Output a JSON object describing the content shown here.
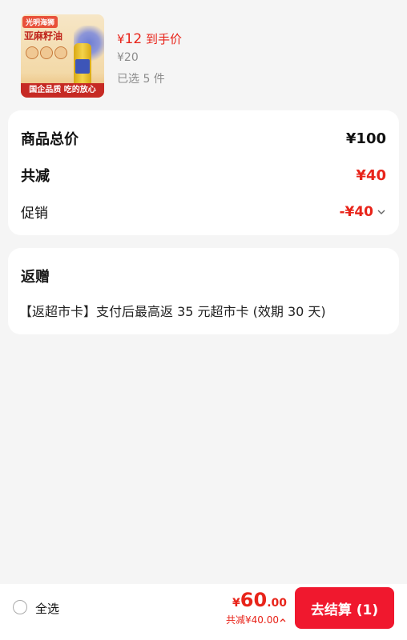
{
  "product": {
    "thumb_brand": "光明海狮",
    "thumb_name": "亚麻籽油",
    "thumb_banner": "国企品质 吃的放心",
    "hand_price_symbol": "¥",
    "hand_price_value": "12",
    "hand_price_label": "到手价",
    "original_price": "¥20",
    "selected_count": "已选 5 件"
  },
  "summary": {
    "total_label": "商品总价",
    "total_value": "¥100",
    "reduce_label": "共减",
    "reduce_value": "¥40",
    "promo_label": "促销",
    "promo_value": "-¥40"
  },
  "gift": {
    "title": "返赠",
    "text": "【返超市卡】支付后最高返 35 元超市卡 (效期 30 天)"
  },
  "bottom": {
    "select_all": "全选",
    "price_symbol": "¥",
    "price_int": "60",
    "price_dec": ".00",
    "reduce_text": "共减¥40.00",
    "checkout_label": "去结算 (1)"
  },
  "colors": {
    "accent": "#e8241a",
    "checkout_bg": "#f0182e",
    "background": "#f5f5f5"
  },
  "icons": {
    "promo_chevron": "chevron-down-icon",
    "bottom_chevron": "chevron-up-icon",
    "select_radio": "radio-unchecked-icon"
  }
}
